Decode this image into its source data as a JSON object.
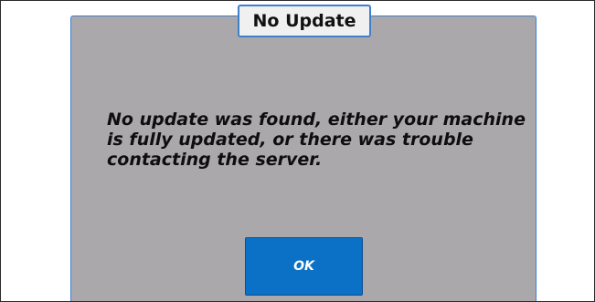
{
  "dialog": {
    "title": "No Update",
    "message": "No update was found, either your machine is fully updated, or there was trouble contacting the server.",
    "ok_label": "OK"
  },
  "colors": {
    "dialog_background": "#aba8ab",
    "dialog_border": "#3f7fc9",
    "button_background": "#0a71c6",
    "button_text": "#ffffff",
    "title_background": "#f0f0f0"
  }
}
